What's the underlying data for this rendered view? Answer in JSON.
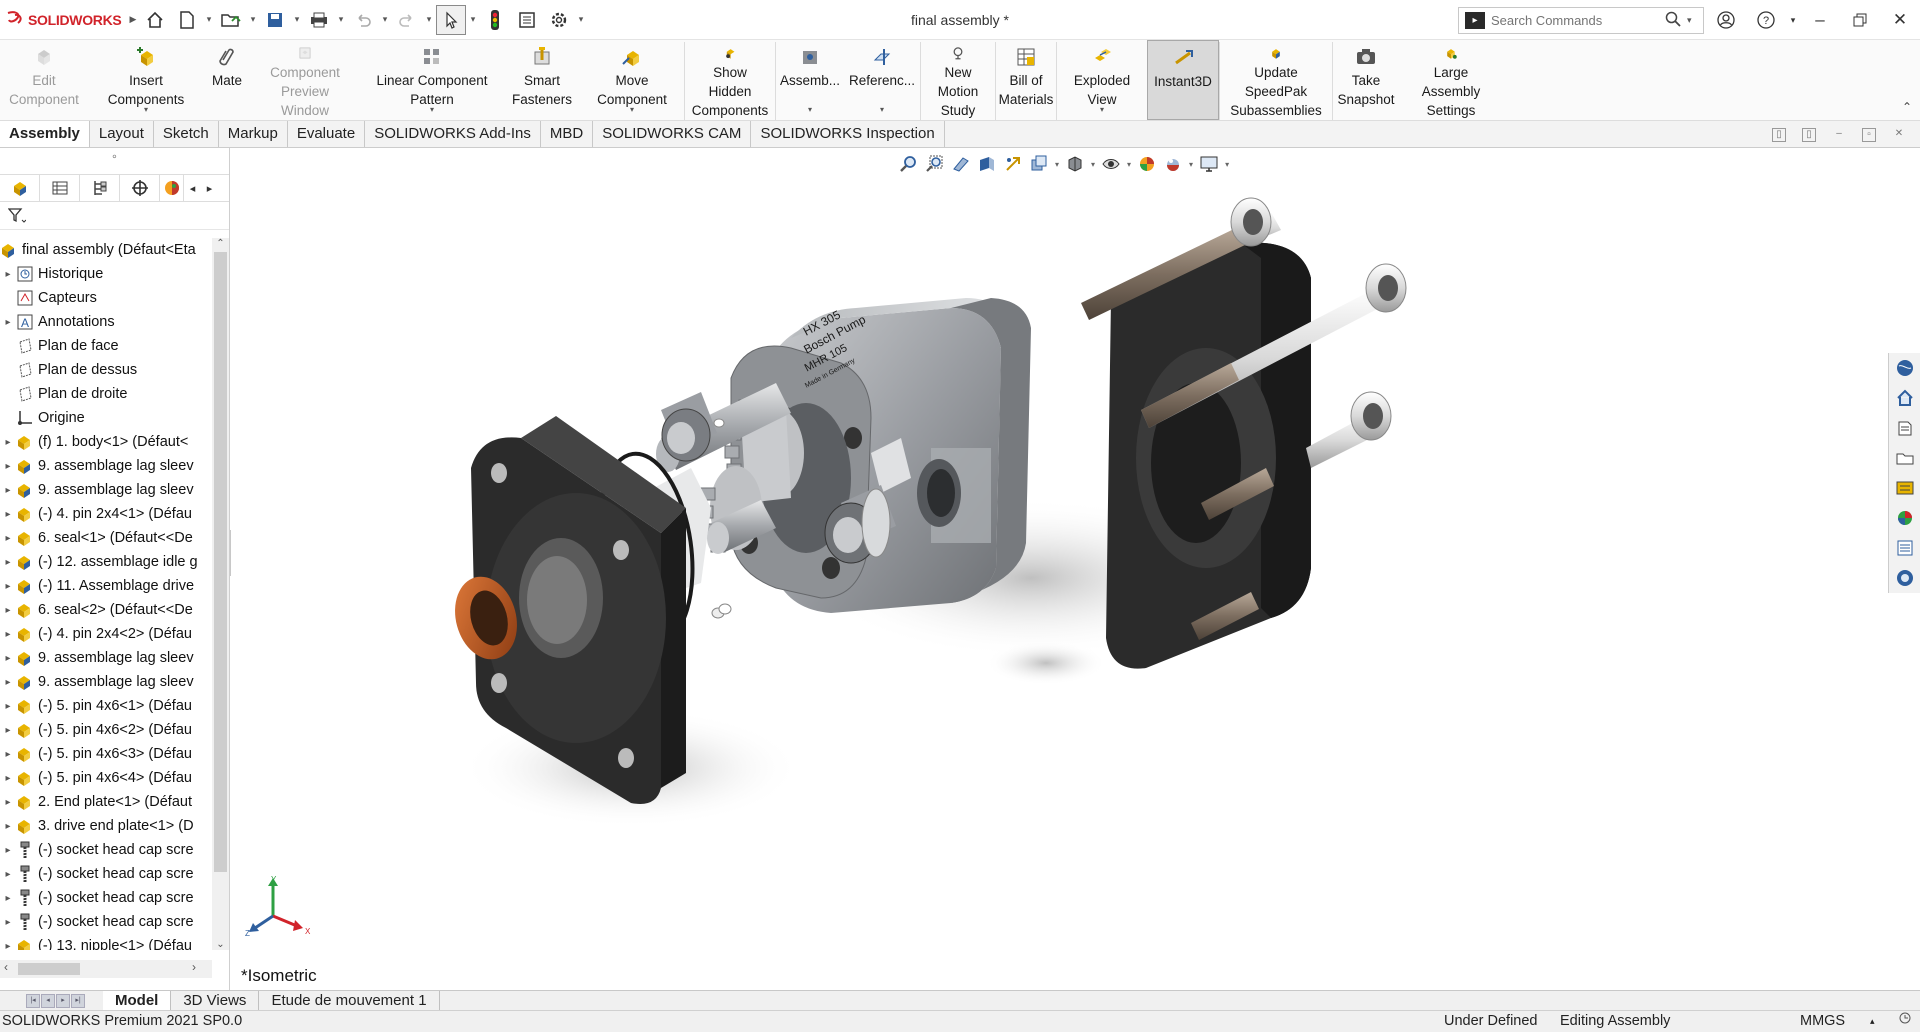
{
  "app": {
    "brand_ds": "3S",
    "brand_name": "SOLIDWORKS",
    "document_title": "final assembly *"
  },
  "search": {
    "placeholder": "Search Commands"
  },
  "command_manager": {
    "tools": [
      {
        "label": "Edit\nComponent",
        "disabled": true
      },
      {
        "label": "Insert Components",
        "disabled": false
      },
      {
        "label": "Mate",
        "disabled": false
      },
      {
        "label": "Component\nPreview Window",
        "disabled": true
      },
      {
        "label": "Linear Component Pattern",
        "disabled": false
      },
      {
        "label": "Smart\nFasteners",
        "disabled": false
      },
      {
        "label": "Move Component",
        "disabled": false
      },
      {
        "label": "Show Hidden\nComponents",
        "disabled": false
      },
      {
        "label": "Assemb...",
        "disabled": false
      },
      {
        "label": "Referenc...",
        "disabled": false
      },
      {
        "label": "New Motion\nStudy",
        "disabled": false
      },
      {
        "label": "Bill of\nMaterials",
        "disabled": false
      },
      {
        "label": "Exploded View",
        "disabled": false
      },
      {
        "label": "Instant3D",
        "disabled": false
      },
      {
        "label": "Update SpeedPak\nSubassemblies",
        "disabled": false
      },
      {
        "label": "Take\nSnapshot",
        "disabled": false
      },
      {
        "label": "Large Assembly\nSettings",
        "disabled": false
      }
    ]
  },
  "tabs": [
    "Assembly",
    "Layout",
    "Sketch",
    "Markup",
    "Evaluate",
    "SOLIDWORKS Add-Ins",
    "MBD",
    "SOLIDWORKS CAM",
    "SOLIDWORKS Inspection"
  ],
  "feature_tree": {
    "root": "final assembly  (Défaut<Eta",
    "items": [
      {
        "label": "Historique",
        "icon": "history-icon",
        "exp": true
      },
      {
        "label": "Capteurs",
        "icon": "sensor-icon",
        "exp": false
      },
      {
        "label": "Annotations",
        "icon": "annotation-icon",
        "exp": true
      },
      {
        "label": "Plan de face",
        "icon": "plane-icon",
        "exp": false
      },
      {
        "label": "Plan de dessus",
        "icon": "plane-icon",
        "exp": false
      },
      {
        "label": "Plan de droite",
        "icon": "plane-icon",
        "exp": false
      },
      {
        "label": "Origine",
        "icon": "origin-icon",
        "exp": false
      },
      {
        "label": "(f) 1. body<1> (Défaut<",
        "icon": "part-icon",
        "exp": true
      },
      {
        "label": "9. assemblage lag sleev",
        "icon": "subassembly-icon",
        "exp": true
      },
      {
        "label": "9. assemblage lag sleev",
        "icon": "subassembly-icon",
        "exp": true
      },
      {
        "label": "(-) 4. pin 2x4<1> (Défau",
        "icon": "part-icon",
        "exp": true
      },
      {
        "label": "6. seal<1> (Défaut<<De",
        "icon": "part-icon",
        "exp": true
      },
      {
        "label": "(-) 12. assemblage idle g",
        "icon": "subassembly-icon",
        "exp": true
      },
      {
        "label": "(-) 11. Assemblage drive",
        "icon": "subassembly-icon",
        "exp": true
      },
      {
        "label": "6. seal<2> (Défaut<<De",
        "icon": "part-icon",
        "exp": true
      },
      {
        "label": "(-) 4. pin 2x4<2> (Défau",
        "icon": "part-icon",
        "exp": true
      },
      {
        "label": "9. assemblage lag sleev",
        "icon": "subassembly-icon",
        "exp": true
      },
      {
        "label": "9. assemblage lag sleev",
        "icon": "subassembly-icon",
        "exp": true
      },
      {
        "label": "(-) 5. pin 4x6<1> (Défau",
        "icon": "part-icon",
        "exp": true
      },
      {
        "label": "(-) 5. pin 4x6<2> (Défau",
        "icon": "part-icon",
        "exp": true
      },
      {
        "label": "(-) 5. pin 4x6<3> (Défau",
        "icon": "part-icon",
        "exp": true
      },
      {
        "label": "(-) 5. pin 4x6<4> (Défau",
        "icon": "part-icon",
        "exp": true
      },
      {
        "label": "2. End plate<1> (Défaut",
        "icon": "part-icon",
        "exp": true
      },
      {
        "label": "3. drive end plate<1> (D",
        "icon": "part-icon",
        "exp": true
      },
      {
        "label": "(-) socket head cap scre",
        "icon": "toolbox-screw-icon",
        "exp": true
      },
      {
        "label": "(-) socket head cap scre",
        "icon": "toolbox-screw-icon",
        "exp": true
      },
      {
        "label": "(-) socket head cap scre",
        "icon": "toolbox-screw-icon",
        "exp": true
      },
      {
        "label": "(-) socket head cap scre",
        "icon": "toolbox-screw-icon",
        "exp": true
      },
      {
        "label": "(-) 13. nipple<1> (Défau",
        "icon": "part-icon",
        "exp": true
      }
    ]
  },
  "viewport": {
    "view_name": "*Isometric",
    "triad": {
      "x": "X",
      "y": "Y",
      "z": "Z"
    },
    "engraving": [
      "HX 305",
      "Bosch Pump",
      "MHR 105",
      "Made in Germany"
    ]
  },
  "bottom_tabs": [
    "Model",
    "3D Views",
    "Etude de mouvement 1"
  ],
  "status": {
    "product": "SOLIDWORKS Premium 2021 SP0.0",
    "state": "Under Defined",
    "mode": "Editing Assembly",
    "units": "MMGS",
    "units_caret": "▴"
  },
  "colors": {
    "brand": "#d1232a",
    "accent_yellow": "#e8b400",
    "body_gray": "#8f9296",
    "plate_black": "#2b2b2b",
    "bronze": "#b5541f"
  }
}
